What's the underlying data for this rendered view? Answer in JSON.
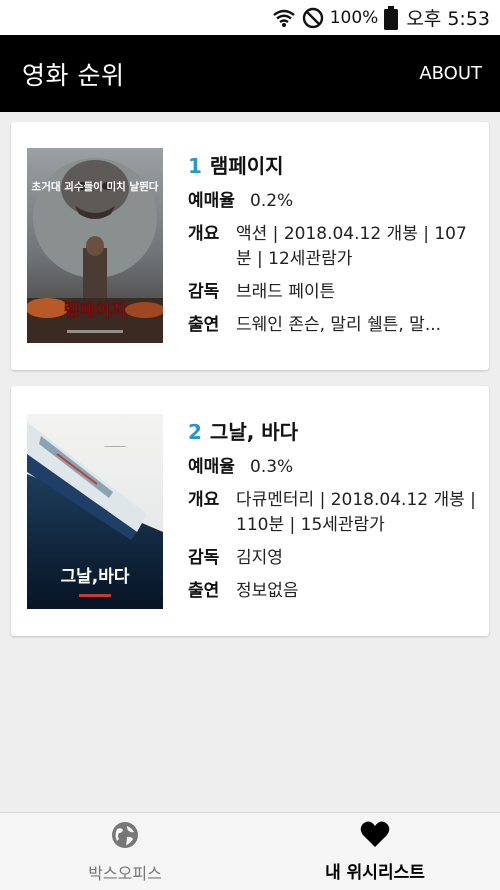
{
  "status_bar": {
    "battery_text": "100%",
    "time": "오후 5:53",
    "icons": [
      "wifi-icon",
      "do-not-disturb-icon",
      "battery-icon"
    ]
  },
  "app_bar": {
    "title": "영화 순위",
    "about_label": "ABOUT"
  },
  "colors": {
    "rank_color": "#2a96c9",
    "app_bar_bg": "#000000",
    "background": "#eeeeee"
  },
  "movies": [
    {
      "rank": "1",
      "title": "램페이지",
      "poster_text": "램페이지",
      "poster_tagline": "초거대 괴수들이 미치 날뛴다",
      "booking_label": "예매율",
      "booking_rate": "0.2%",
      "summary_label": "개요",
      "summary": "액션 | 2018.04.12 개봉 | 107분 | 12세관람가",
      "director_label": "감독",
      "director": "브래드 페이튼",
      "cast_label": "출연",
      "cast": "드웨인 존슨, 말리 쉘튼, 말..."
    },
    {
      "rank": "2",
      "title": "그날, 바다",
      "poster_text": "그날,바다",
      "booking_label": "예매율",
      "booking_rate": "0.3%",
      "summary_label": "개요",
      "summary": "다큐멘터리 | 2018.04.12 개봉 | 110분 | 15세관람가",
      "director_label": "감독",
      "director": "김지영",
      "cast_label": "출연",
      "cast": "정보없음"
    }
  ],
  "bottom_nav": {
    "tabs": [
      {
        "label": "박스오피스",
        "icon": "globe-icon",
        "active": false
      },
      {
        "label": "내 위시리스트",
        "icon": "heart-icon",
        "active": true
      }
    ]
  }
}
